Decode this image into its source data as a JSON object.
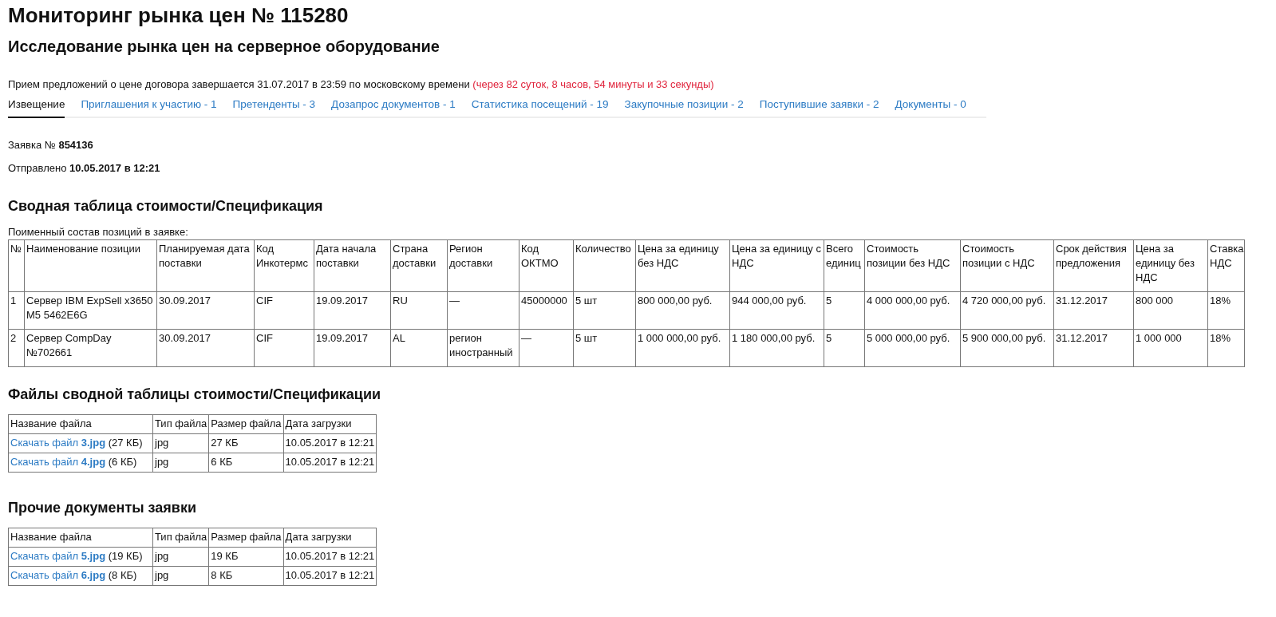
{
  "title": "Мониторинг рынка цен № 115280",
  "subtitle": "Исследование рынка цен на серверное оборудование",
  "deadline": {
    "text": "Прием предложений о цене договора завершается 31.07.2017 в 23:59 по московскому времени",
    "remaining": "(через 82 суток, 8 часов, 54 минуты и 33 секунды)"
  },
  "tabs": [
    {
      "label": "Извещение",
      "selected": true
    },
    {
      "label": "Приглашения к участию - 1",
      "selected": false
    },
    {
      "label": "Претенденты - 3",
      "selected": false
    },
    {
      "label": "Дозапрос документов - 1",
      "selected": false
    },
    {
      "label": "Статистика посещений - 19",
      "selected": false
    },
    {
      "label": "Закупочные позиции - 2",
      "selected": false
    },
    {
      "label": "Поступившие заявки - 2",
      "selected": false
    },
    {
      "label": "Документы - 0",
      "selected": false
    }
  ],
  "application": "Заявка № **854136**",
  "sent": "Отправлено **10.05.2017 в 12:21**",
  "spec": {
    "heading": "Сводная таблица стоимости/Спецификация",
    "caption": "Поименный состав позиций в заявке:",
    "columns": [
      "№",
      "Наименование позиции",
      "Планируемая дата поставки",
      "Код Инкотермс",
      "Дата начала поставки",
      "Страна доставки",
      "Регион доставки",
      "Код ОКТМО",
      "Количество",
      "Цена за единицу без НДС",
      "Цена за единицу с НДС",
      "Всего единиц",
      "Стоимость позиции без НДС",
      "Стоимость позиции с НДС",
      "Срок действия предложения",
      "Цена за единицу без НДС",
      "Ставка НДС"
    ],
    "rows": [
      [
        "1",
        "Сервер IBM ExpSell x3650 M5 5462E6G",
        "30.09.2017",
        "CIF",
        "19.09.2017",
        "RU",
        "—",
        "45000000",
        "5 шт",
        "800 000,00 руб.",
        "944 000,00 руб.",
        "5",
        "4 000 000,00 руб.",
        "4 720 000,00 руб.",
        "31.12.2017",
        "800 000",
        "18%"
      ],
      [
        "2",
        "Сервер CompDay №702661",
        "30.09.2017",
        "CIF",
        "19.09.2017",
        "AL",
        "регион иностранный",
        "—",
        "5 шт",
        "1 000 000,00 руб.",
        "1 180 000,00 руб.",
        "5",
        "5 000 000,00 руб.",
        "5 900 000,00 руб.",
        "31.12.2017",
        "1 000 000",
        "18%"
      ]
    ]
  },
  "file_sections": [
    {
      "heading": "Файлы сводной таблицы стоимости/Спецификации",
      "columns": [
        "Название файла",
        "Тип файла",
        "Размер файла",
        "Дата загрузки"
      ],
      "rows": [
        {
          "link": "Скачать файл **3.jpg**",
          "note": "(27 КБ)",
          "type": "jpg",
          "size": "27 КБ",
          "date": "10.05.2017 в 12:21"
        },
        {
          "link": "Скачать файл **4.jpg**",
          "note": "(6 КБ)",
          "type": "jpg",
          "size": "6 КБ",
          "date": "10.05.2017 в 12:21"
        }
      ]
    },
    {
      "heading": "Прочие документы заявки",
      "columns": [
        "Название файла",
        "Тип файла",
        "Размер файла",
        "Дата загрузки"
      ],
      "rows": [
        {
          "link": "Скачать файл **5.jpg**",
          "note": "(19 КБ)",
          "type": "jpg",
          "size": "19 КБ",
          "date": "10.05.2017 в 12:21"
        },
        {
          "link": "Скачать файл **6.jpg**",
          "note": "(8 КБ)",
          "type": "jpg",
          "size": "8 КБ",
          "date": "10.05.2017 в 12:21"
        }
      ]
    }
  ]
}
